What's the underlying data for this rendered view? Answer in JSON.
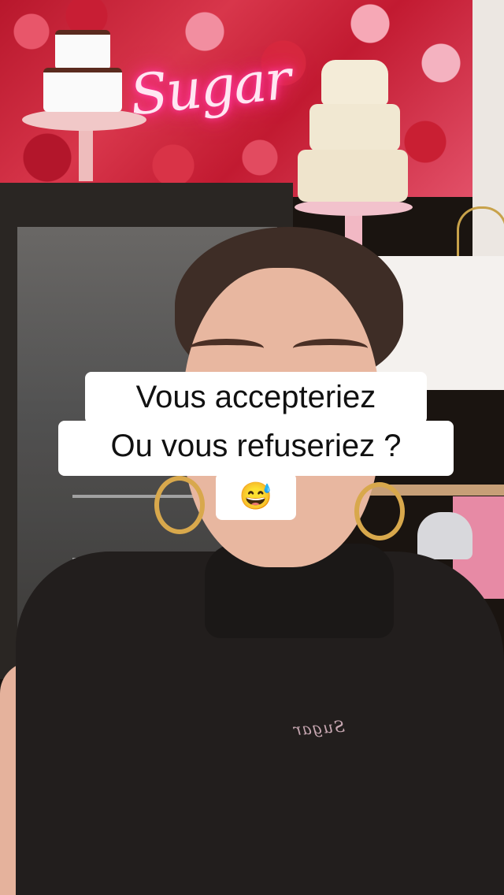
{
  "video": {
    "neon_sign": "Sugar",
    "jacket_embroidery": "Sugar",
    "caption": {
      "line1": "Vous accepteriez",
      "line2": "Ou vous refuseriez ?",
      "emoji": "😅"
    }
  }
}
